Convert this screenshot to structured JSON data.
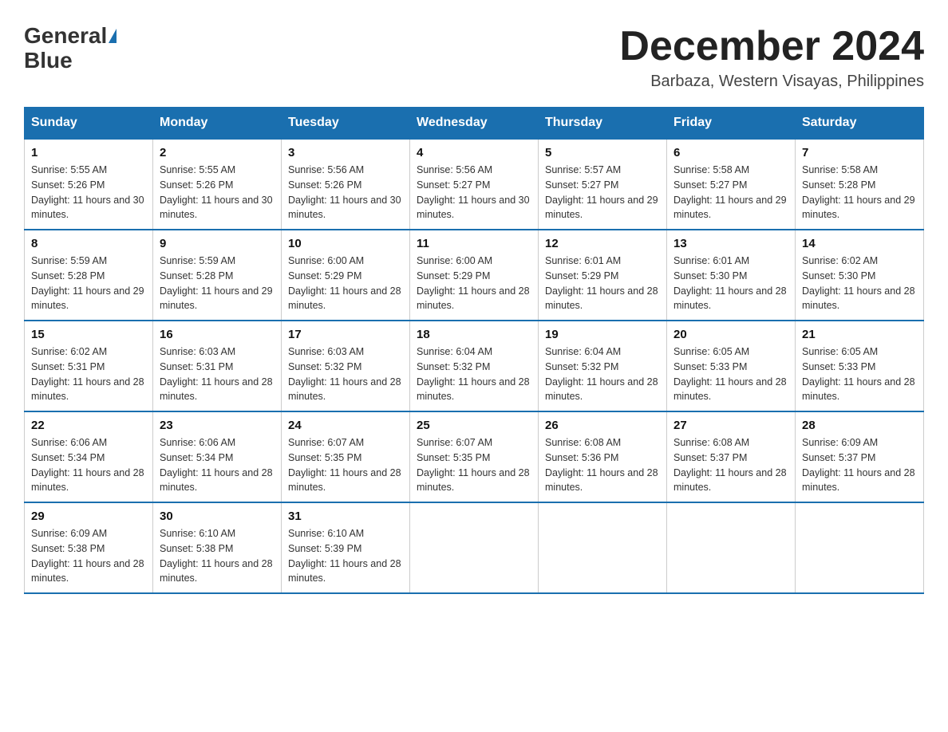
{
  "logo": {
    "general": "General",
    "blue": "Blue"
  },
  "header": {
    "month": "December 2024",
    "location": "Barbaza, Western Visayas, Philippines"
  },
  "days": [
    "Sunday",
    "Monday",
    "Tuesday",
    "Wednesday",
    "Thursday",
    "Friday",
    "Saturday"
  ],
  "weeks": [
    [
      {
        "day": "1",
        "sunrise": "5:55 AM",
        "sunset": "5:26 PM",
        "daylight": "11 hours and 30 minutes."
      },
      {
        "day": "2",
        "sunrise": "5:55 AM",
        "sunset": "5:26 PM",
        "daylight": "11 hours and 30 minutes."
      },
      {
        "day": "3",
        "sunrise": "5:56 AM",
        "sunset": "5:26 PM",
        "daylight": "11 hours and 30 minutes."
      },
      {
        "day": "4",
        "sunrise": "5:56 AM",
        "sunset": "5:27 PM",
        "daylight": "11 hours and 30 minutes."
      },
      {
        "day": "5",
        "sunrise": "5:57 AM",
        "sunset": "5:27 PM",
        "daylight": "11 hours and 29 minutes."
      },
      {
        "day": "6",
        "sunrise": "5:58 AM",
        "sunset": "5:27 PM",
        "daylight": "11 hours and 29 minutes."
      },
      {
        "day": "7",
        "sunrise": "5:58 AM",
        "sunset": "5:28 PM",
        "daylight": "11 hours and 29 minutes."
      }
    ],
    [
      {
        "day": "8",
        "sunrise": "5:59 AM",
        "sunset": "5:28 PM",
        "daylight": "11 hours and 29 minutes."
      },
      {
        "day": "9",
        "sunrise": "5:59 AM",
        "sunset": "5:28 PM",
        "daylight": "11 hours and 29 minutes."
      },
      {
        "day": "10",
        "sunrise": "6:00 AM",
        "sunset": "5:29 PM",
        "daylight": "11 hours and 28 minutes."
      },
      {
        "day": "11",
        "sunrise": "6:00 AM",
        "sunset": "5:29 PM",
        "daylight": "11 hours and 28 minutes."
      },
      {
        "day": "12",
        "sunrise": "6:01 AM",
        "sunset": "5:29 PM",
        "daylight": "11 hours and 28 minutes."
      },
      {
        "day": "13",
        "sunrise": "6:01 AM",
        "sunset": "5:30 PM",
        "daylight": "11 hours and 28 minutes."
      },
      {
        "day": "14",
        "sunrise": "6:02 AM",
        "sunset": "5:30 PM",
        "daylight": "11 hours and 28 minutes."
      }
    ],
    [
      {
        "day": "15",
        "sunrise": "6:02 AM",
        "sunset": "5:31 PM",
        "daylight": "11 hours and 28 minutes."
      },
      {
        "day": "16",
        "sunrise": "6:03 AM",
        "sunset": "5:31 PM",
        "daylight": "11 hours and 28 minutes."
      },
      {
        "day": "17",
        "sunrise": "6:03 AM",
        "sunset": "5:32 PM",
        "daylight": "11 hours and 28 minutes."
      },
      {
        "day": "18",
        "sunrise": "6:04 AM",
        "sunset": "5:32 PM",
        "daylight": "11 hours and 28 minutes."
      },
      {
        "day": "19",
        "sunrise": "6:04 AM",
        "sunset": "5:32 PM",
        "daylight": "11 hours and 28 minutes."
      },
      {
        "day": "20",
        "sunrise": "6:05 AM",
        "sunset": "5:33 PM",
        "daylight": "11 hours and 28 minutes."
      },
      {
        "day": "21",
        "sunrise": "6:05 AM",
        "sunset": "5:33 PM",
        "daylight": "11 hours and 28 minutes."
      }
    ],
    [
      {
        "day": "22",
        "sunrise": "6:06 AM",
        "sunset": "5:34 PM",
        "daylight": "11 hours and 28 minutes."
      },
      {
        "day": "23",
        "sunrise": "6:06 AM",
        "sunset": "5:34 PM",
        "daylight": "11 hours and 28 minutes."
      },
      {
        "day": "24",
        "sunrise": "6:07 AM",
        "sunset": "5:35 PM",
        "daylight": "11 hours and 28 minutes."
      },
      {
        "day": "25",
        "sunrise": "6:07 AM",
        "sunset": "5:35 PM",
        "daylight": "11 hours and 28 minutes."
      },
      {
        "day": "26",
        "sunrise": "6:08 AM",
        "sunset": "5:36 PM",
        "daylight": "11 hours and 28 minutes."
      },
      {
        "day": "27",
        "sunrise": "6:08 AM",
        "sunset": "5:37 PM",
        "daylight": "11 hours and 28 minutes."
      },
      {
        "day": "28",
        "sunrise": "6:09 AM",
        "sunset": "5:37 PM",
        "daylight": "11 hours and 28 minutes."
      }
    ],
    [
      {
        "day": "29",
        "sunrise": "6:09 AM",
        "sunset": "5:38 PM",
        "daylight": "11 hours and 28 minutes."
      },
      {
        "day": "30",
        "sunrise": "6:10 AM",
        "sunset": "5:38 PM",
        "daylight": "11 hours and 28 minutes."
      },
      {
        "day": "31",
        "sunrise": "6:10 AM",
        "sunset": "5:39 PM",
        "daylight": "11 hours and 28 minutes."
      },
      null,
      null,
      null,
      null
    ]
  ]
}
